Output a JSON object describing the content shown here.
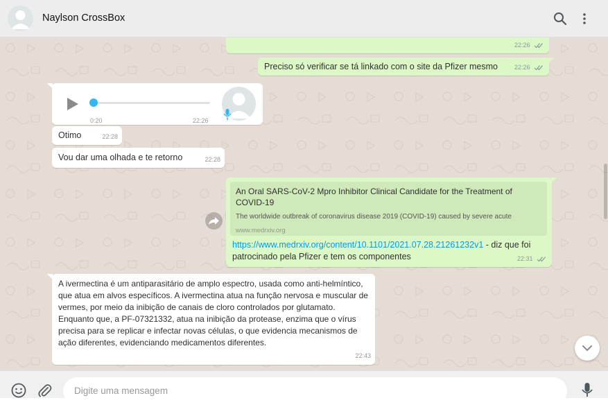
{
  "header": {
    "contact_name": "Naylson CrossBox"
  },
  "messages": {
    "m1": {
      "time": "22:26"
    },
    "m2": {
      "text": "Preciso só verificar se tá linkado com o site da Pfizer mesmo",
      "time": "22:26"
    },
    "voice": {
      "duration": "0:20",
      "time": "22:26",
      "progress": 0.0
    },
    "m3": {
      "text": "Otimo",
      "time": "22:28"
    },
    "m4": {
      "text": "Vou dar uma olhada e te retorno",
      "time": "22:28"
    },
    "m5": {
      "preview_title": "An Oral SARS-CoV-2 Mpro Inhibitor Clinical Candidate for the Treatment of COVID-19",
      "preview_desc": "The worldwide outbreak of coronavirus disease 2019 (COVID-19) caused by severe acute",
      "preview_domain": "www.medrxiv.org",
      "link": "https://www.medrxiv.org/content/10.1101/2021.07.28.21261232v1",
      "text_after_link": " - diz que foi patrocinado pela Pfizer e tem os componentes",
      "time": "22:31"
    },
    "m6": {
      "text": "A ivermectina é um antiparasitário de amplo espectro, usada como anti-helmíntico, que atua em alvos específicos. A ivermectina atua na função nervosa e muscular de vermes, por meio da inibição de canais de cloro controlados por glutamato. Enquanto que, a PF-07321332, atua na inibição da protease, enzima que o vírus precisa para se replicar e infectar novas células, o que evidencia mecanismos de ação diferentes, evidenciando medicamentos diferentes.",
      "time": "22:43"
    }
  },
  "composer": {
    "placeholder": "Digite uma mensagem"
  },
  "colors": {
    "outgoing": "#dcf8c6",
    "incoming": "#ffffff",
    "background": "#e5ddd5",
    "accent": "#34b7f1"
  },
  "icons": [
    "default-avatar-icon",
    "search-icon",
    "menu-icon",
    "play-icon",
    "microphone-icon",
    "forward-icon",
    "chevron-down-icon",
    "emoji-icon",
    "attach-icon",
    "mic-icon",
    "double-check-icon"
  ]
}
